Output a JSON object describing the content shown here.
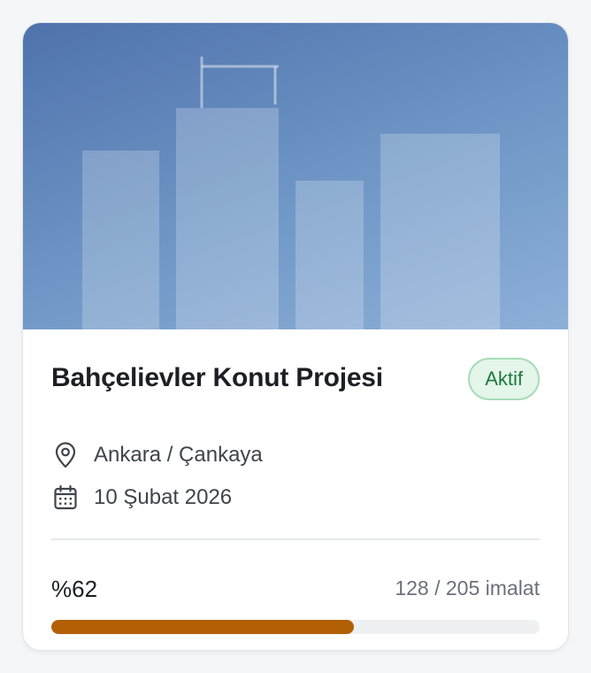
{
  "project": {
    "title": "Bahçelievler Konut Projesi",
    "status": "Aktif",
    "location": "Ankara / Çankaya",
    "date": "10 Şubat 2026",
    "progress_label": "%62",
    "progress_fraction": 0.62,
    "count_label": "128 / 205 imalat"
  },
  "icons": {
    "location": "map-pin-icon",
    "date": "calendar-icon"
  },
  "colors": {
    "status_bg": "#e4f5ea",
    "status_text": "#1c7a3b",
    "progress_fill": "#b25f05",
    "hero_start": "#4f72ad",
    "hero_end": "#8db0d8"
  }
}
